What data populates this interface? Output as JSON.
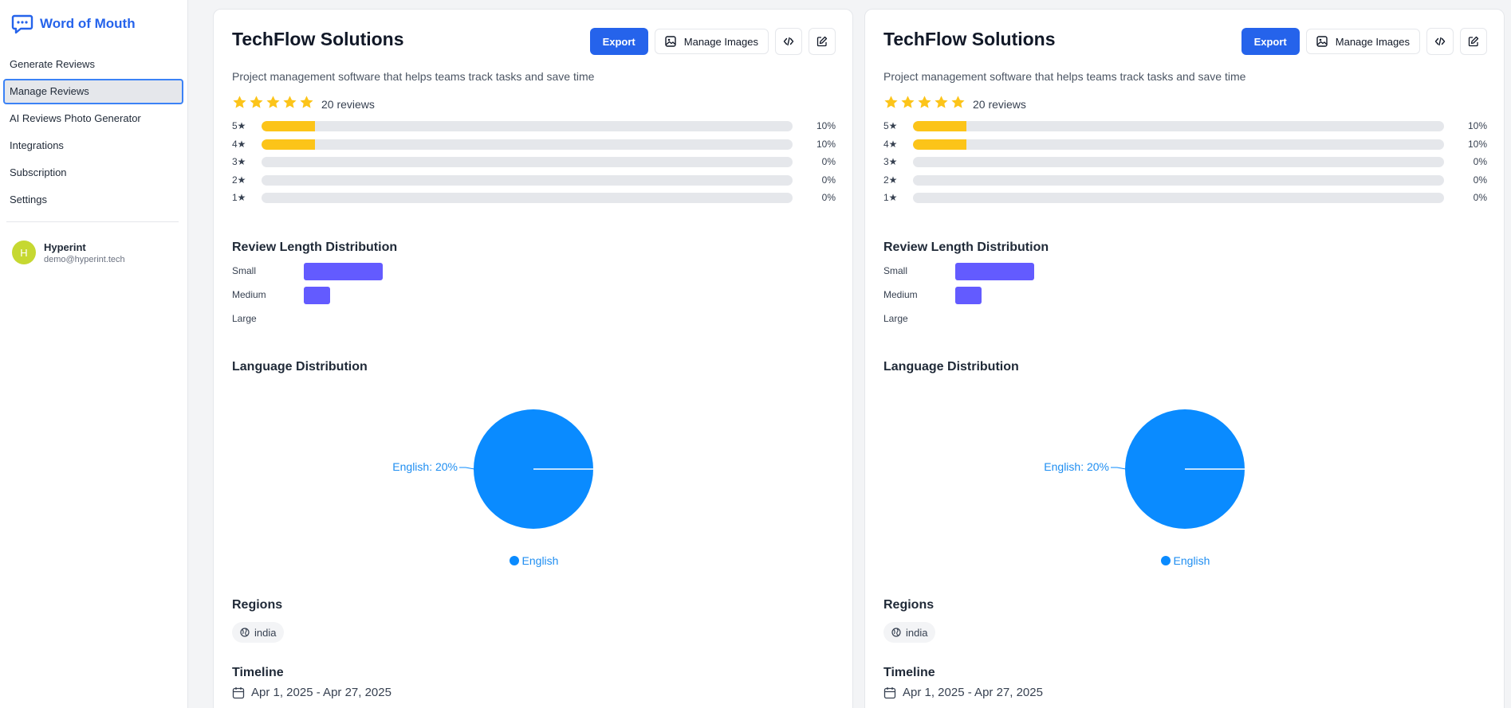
{
  "app": {
    "title": "Word of Mouth"
  },
  "sidebar": {
    "items": [
      {
        "label": "Generate Reviews"
      },
      {
        "label": "Manage Reviews",
        "active": true
      },
      {
        "label": "AI Reviews Photo Generator"
      },
      {
        "label": "Integrations"
      },
      {
        "label": "Subscription"
      },
      {
        "label": "Settings"
      }
    ],
    "user": {
      "initial": "H",
      "name": "Hyperint",
      "email": "demo@hyperint.tech"
    }
  },
  "cards": [
    {
      "title": "TechFlow Solutions",
      "export_label": "Export",
      "manage_images_label": "Manage Images",
      "description": "Project management software that helps teams track tasks and save time",
      "rating_stars": 5,
      "review_count": "20 reviews",
      "rating_distribution": [
        {
          "label": "5★",
          "percent": 10,
          "percent_text": "10%"
        },
        {
          "label": "4★",
          "percent": 10,
          "percent_text": "10%"
        },
        {
          "label": "3★",
          "percent": 0,
          "percent_text": "0%"
        },
        {
          "label": "2★",
          "percent": 0,
          "percent_text": "0%"
        },
        {
          "label": "1★",
          "percent": 0,
          "percent_text": "0%"
        }
      ],
      "length_title": "Review Length Distribution",
      "length_distribution": [
        {
          "label": "Small",
          "value": 3
        },
        {
          "label": "Medium",
          "value": 1
        },
        {
          "label": "Large",
          "value": 0
        }
      ],
      "language_title": "Language Distribution",
      "chart_data": {
        "type": "pie",
        "slices": [
          {
            "name": "English",
            "value": 20,
            "label": "English: 20%",
            "color": "#0a8bff"
          }
        ]
      },
      "legend_label": "English",
      "regions_title": "Regions",
      "regions": [
        "india"
      ],
      "timeline_title": "Timeline",
      "timeline": "Apr 1, 2025 - Apr 27, 2025"
    },
    {
      "title": "TechFlow Solutions",
      "export_label": "Export",
      "manage_images_label": "Manage Images",
      "description": "Project management software that helps teams track tasks and save time",
      "rating_stars": 5,
      "review_count": "20 reviews",
      "rating_distribution": [
        {
          "label": "5★",
          "percent": 10,
          "percent_text": "10%"
        },
        {
          "label": "4★",
          "percent": 10,
          "percent_text": "10%"
        },
        {
          "label": "3★",
          "percent": 0,
          "percent_text": "0%"
        },
        {
          "label": "2★",
          "percent": 0,
          "percent_text": "0%"
        },
        {
          "label": "1★",
          "percent": 0,
          "percent_text": "0%"
        }
      ],
      "length_title": "Review Length Distribution",
      "length_distribution": [
        {
          "label": "Small",
          "value": 3
        },
        {
          "label": "Medium",
          "value": 1
        },
        {
          "label": "Large",
          "value": 0
        }
      ],
      "language_title": "Language Distribution",
      "chart_data": {
        "type": "pie",
        "slices": [
          {
            "name": "English",
            "value": 20,
            "label": "English: 20%",
            "color": "#0a8bff"
          }
        ]
      },
      "legend_label": "English",
      "regions_title": "Regions",
      "regions": [
        "india"
      ],
      "timeline_title": "Timeline",
      "timeline": "Apr 1, 2025 - Apr 27, 2025"
    }
  ],
  "colors": {
    "accent": "#2563eb",
    "star": "#fcc419",
    "length_bar": "#635bff",
    "pie": "#0a8bff"
  },
  "icons": {
    "brand": "chat-bubble-icon",
    "image": "image-icon",
    "code": "code-icon",
    "edit": "edit-icon",
    "region": "globe-icon",
    "timeline": "calendar-icon"
  }
}
